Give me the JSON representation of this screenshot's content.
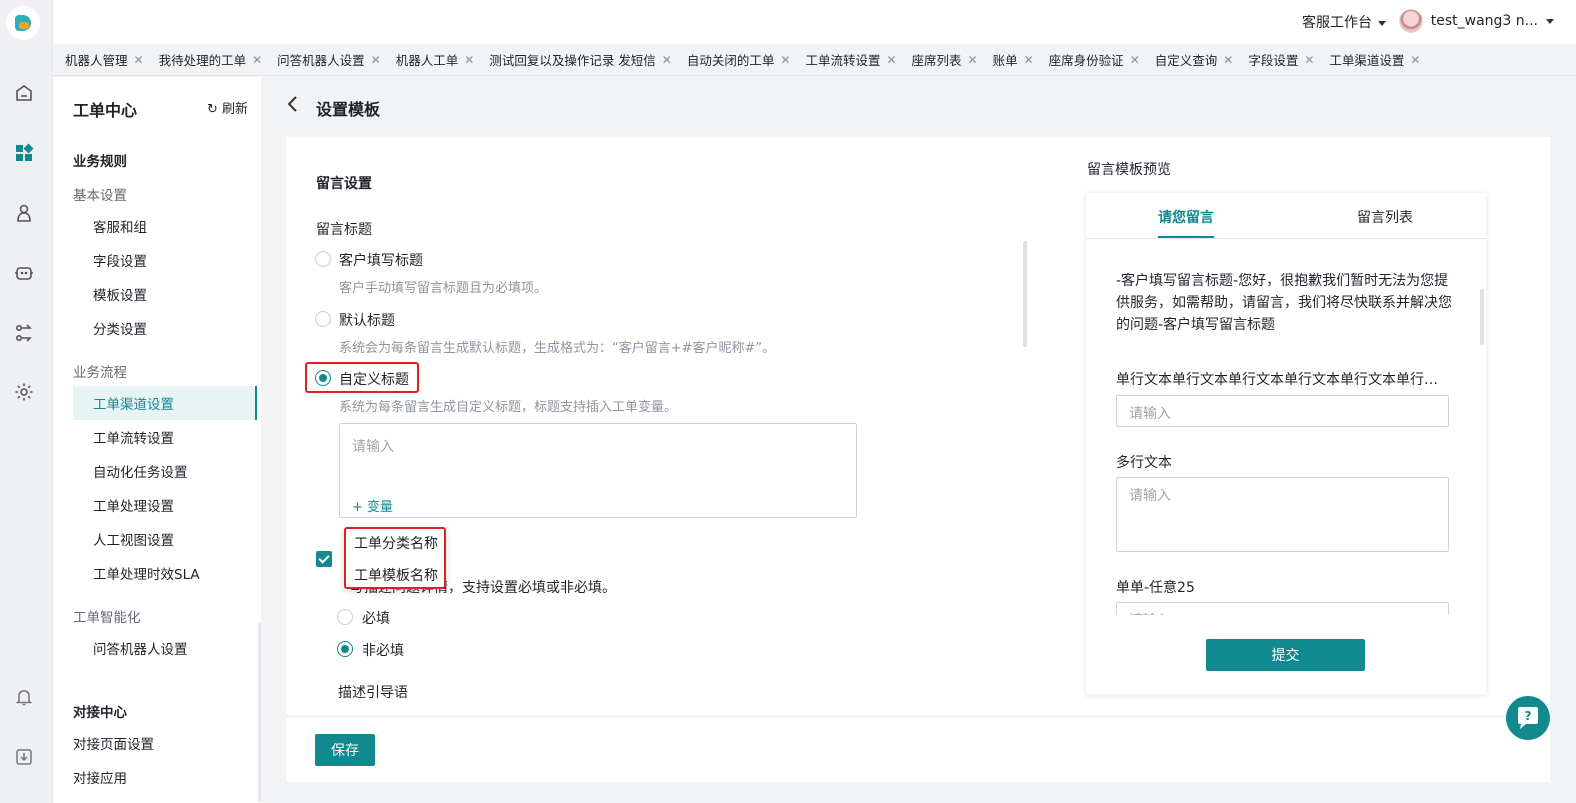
{
  "header": {
    "workspace": "客服工作台",
    "user_name": "test_wang3 n..."
  },
  "tabs": [
    "机器人管理",
    "我待处理的工单",
    "问答机器人设置",
    "机器人工单",
    "测试回复以及操作记录 发短信",
    "自动关闭的工单",
    "工单流转设置",
    "座席列表",
    "账单",
    "座席身份验证",
    "自定义查询",
    "字段设置",
    "工单渠道设置"
  ],
  "sidebar": {
    "title": "工单中心",
    "refresh": "刷新",
    "group_rules": "业务规则",
    "sub_basic": "基本设置",
    "basic_items": [
      "客服和组",
      "字段设置",
      "模板设置",
      "分类设置"
    ],
    "sub_flow": "业务流程",
    "flow_items": [
      "工单渠道设置",
      "工单流转设置",
      "自动化任务设置",
      "工单处理设置",
      "人工视图设置",
      "工单处理时效SLA"
    ],
    "sub_ai": "工单智能化",
    "ai_items": [
      "问答机器人设置"
    ],
    "group_connect": "对接中心",
    "connect_items": [
      "对接页面设置",
      "对接应用"
    ]
  },
  "page": {
    "title": "设置模板",
    "section_title": "留言设置",
    "title_label": "留言标题",
    "option1": "客户填写标题",
    "option1_hint": "客户手动填写留言标题且为必填项。",
    "option2": "默认标题",
    "option2_hint": "系统会为每条留言生成默认标题，生成格式为：“客户留言+#客户昵称#”。",
    "option3": "自定义标题",
    "option3_hint": "系统为每条留言生成自定义标题，标题支持插入工单变量。",
    "textarea_placeholder": "请输入",
    "variable_button": "+ 变量",
    "dropdown_items": [
      "工单分类名称",
      "工单模板名称"
    ],
    "desc_hint_partial": "写描述问题详情，支持设置必填或非必填。",
    "required": "必填",
    "not_required": "非必填",
    "guide_label": "描述引导语",
    "save": "保存"
  },
  "preview": {
    "title": "留言模板预览",
    "tab_active": "请您留言",
    "tab_other": "留言列表",
    "intro": "-客户填写留言标题-您好，很抱歉我们暂时无法为您提供服务，如需帮助，请留言，我们将尽快联系并解决您的问题-客户填写留言标题",
    "field1_label": "单行文本单行文本单行文本单行文本单行文本单行文...",
    "field2_label": "多行文本",
    "field3_label": "单单-任意25",
    "placeholder": "请输入",
    "submit": "提交"
  },
  "colors": {
    "accent": "#10898f",
    "highlight": "#e02020"
  }
}
